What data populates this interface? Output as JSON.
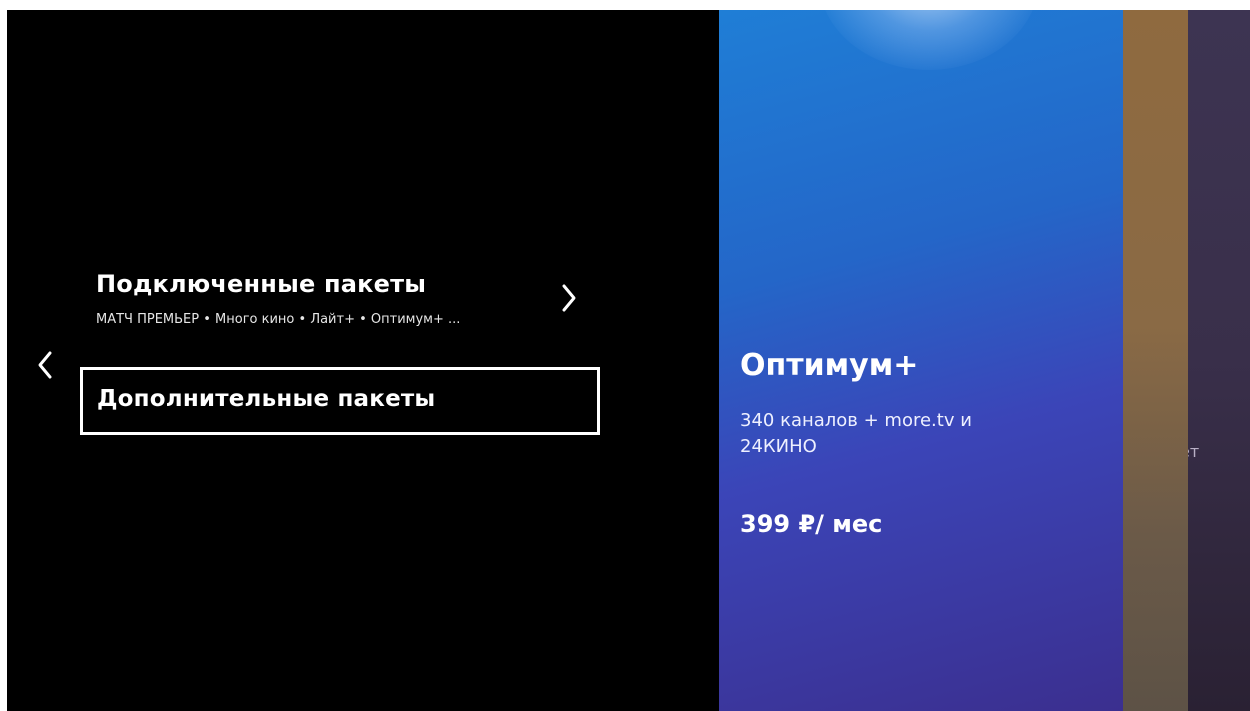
{
  "nav": {
    "back_icon": "chevron-left-icon"
  },
  "menu": {
    "connected": {
      "title": "Подключенные пакеты",
      "subtitle": "МАТЧ ПРЕМЬЕР • Много кино • Лайт+ • Оптимум+ ...",
      "icon": "chevron-right-icon"
    },
    "additional": {
      "title": "Дополнительные пакеты"
    }
  },
  "cards": [
    {
      "name": "Оптимум+",
      "description": "340 каналов + more.tv и 24КИНО",
      "price": "399 ₽/ мес"
    },
    {
      "partial_text": "ет"
    }
  ],
  "colors": {
    "background": "#000000",
    "card_optimum": "#2466c8",
    "card_second": "#8a6a45",
    "card_third": "#392f4a",
    "text": "#ffffff"
  }
}
